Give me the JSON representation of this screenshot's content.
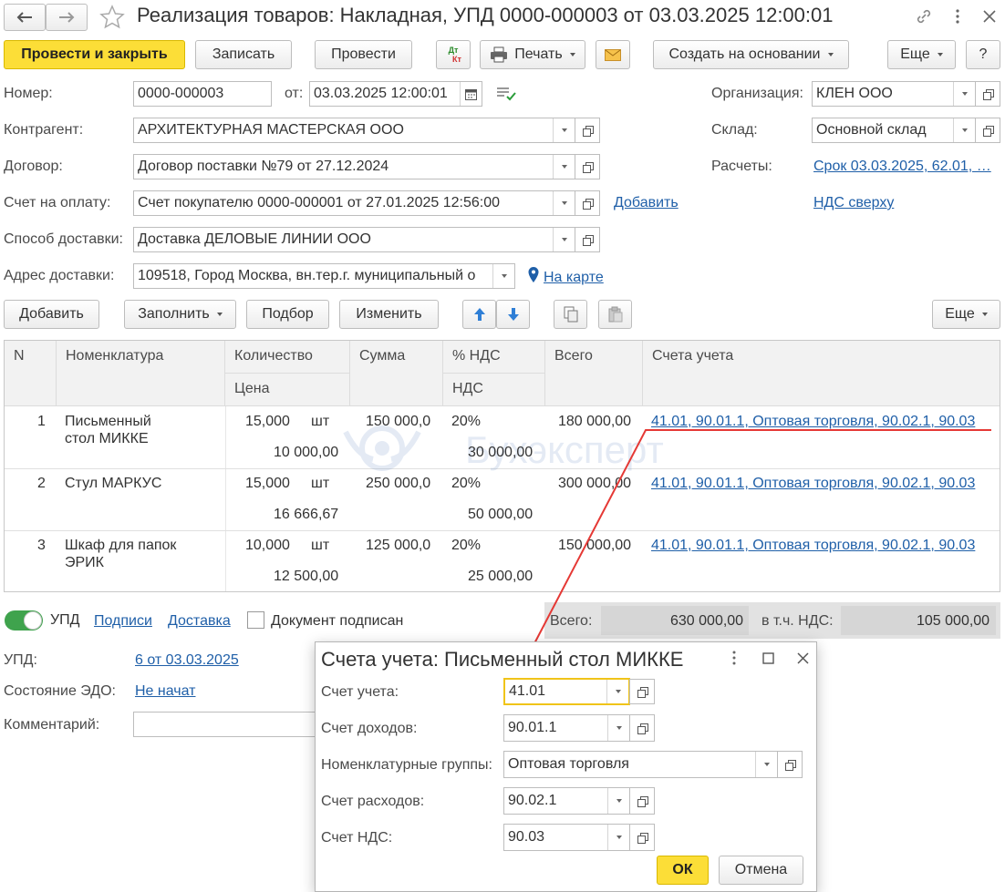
{
  "window": {
    "title": "Реализация товаров: Накладная, УПД 0000-000003 от 03.03.2025 12:00:01"
  },
  "toolbar": {
    "post_close": "Провести и закрыть",
    "save": "Записать",
    "post": "Провести",
    "dtkt_dt": "Дт",
    "dtkt_kt": "Кт",
    "print": "Печать",
    "create_based": "Создать на основании",
    "more": "Еще",
    "help": "?"
  },
  "form": {
    "number_label": "Номер:",
    "number": "0000-000003",
    "date_label": "от:",
    "date": "03.03.2025 12:00:01",
    "org_label": "Организация:",
    "org": "КЛЕН ООО",
    "contractor_label": "Контрагент:",
    "contractor": "АРХИТЕКТУРНАЯ МАСТЕРСКАЯ ООО",
    "warehouse_label": "Склад:",
    "warehouse": "Основной склад",
    "contract_label": "Договор:",
    "contract": "Договор поставки №79 от 27.12.2024",
    "settlements_label": "Расчеты:",
    "settlements": "Срок 03.03.2025, 62.01, …",
    "invoice_label": "Счет на оплату:",
    "invoice": "Счет покупателю 0000-000001 от 27.01.2025 12:56:00",
    "invoice_add": "Добавить",
    "vat_mode": "НДС сверху",
    "delivery_method_label": "Способ доставки:",
    "delivery_method": "Доставка ДЕЛОВЫЕ ЛИНИИ ООО",
    "delivery_address_label": "Адрес доставки:",
    "delivery_address": "109518, Город Москва, вн.тер.г. муниципальный о",
    "on_map": "На карте"
  },
  "table_toolbar": {
    "add": "Добавить",
    "fill": "Заполнить",
    "pick": "Подбор",
    "change": "Изменить",
    "more": "Еще"
  },
  "table": {
    "headers": {
      "n": "N",
      "item": "Номенклатура",
      "qty": "Количество",
      "price": "Цена",
      "sum": "Сумма",
      "vat_rate": "% НДС",
      "vat": "НДС",
      "total": "Всего",
      "accounts": "Счета учета"
    },
    "rows": [
      {
        "n": "1",
        "item1": "Письменный",
        "item2": "стол МИККЕ",
        "qty": "15,000",
        "unit": "шт",
        "price": "10 000,00",
        "sum": "150 000,0",
        "vat_rate": "20%",
        "vat": "30 000,00",
        "total": "180 000,00",
        "accounts": "41.01, 90.01.1, Оптовая торговля, 90.02.1, 90.03"
      },
      {
        "n": "2",
        "item1": "Стул МАРКУС",
        "item2": "",
        "qty": "15,000",
        "unit": "шт",
        "price": "16 666,67",
        "sum": "250 000,0",
        "vat_rate": "20%",
        "vat": "50 000,00",
        "total": "300 000,00",
        "accounts": "41.01, 90.01.1, Оптовая торговля, 90.02.1, 90.03"
      },
      {
        "n": "3",
        "item1": "Шкаф для папок",
        "item2": "ЭРИК",
        "qty": "10,000",
        "unit": "шт",
        "price": "12 500,00",
        "sum": "125 000,0",
        "vat_rate": "20%",
        "vat": "25 000,00",
        "total": "150 000,00",
        "accounts": "41.01, 90.01.1, Оптовая торговля, 90.02.1, 90.03"
      }
    ]
  },
  "footer": {
    "upd_toggle": "УПД",
    "signatures": "Подписи",
    "delivery": "Доставка",
    "signed": "Документ подписан",
    "total_label": "Всего:",
    "total": "630 000,00",
    "vat_label": "в т.ч. НДС:",
    "vat_total": "105 000,00",
    "upd_label": "УПД:",
    "upd_link": "6 от 03.03.2025",
    "edo_label": "Состояние ЭДО:",
    "edo_link": "Не начат",
    "comment_label": "Комментарий:"
  },
  "dialog": {
    "title": "Счета учета: Письменный стол МИККЕ",
    "account_label": "Счет учета:",
    "account": "41.01",
    "income_label": "Счет доходов:",
    "income": "90.01.1",
    "groups_label": "Номенклатурные группы:",
    "groups": "Оптовая торговля",
    "expense_label": "Счет расходов:",
    "expense": "90.02.1",
    "vat_label": "Счет НДС:",
    "vat": "90.03",
    "ok": "ОК",
    "cancel": "Отмена"
  },
  "watermark": "Бухэксперт",
  "colors": {
    "accent_yellow": "#fcde37",
    "link_blue": "#1f5fa8",
    "toggle_green": "#3fa34d",
    "callout_red": "#e53935"
  }
}
